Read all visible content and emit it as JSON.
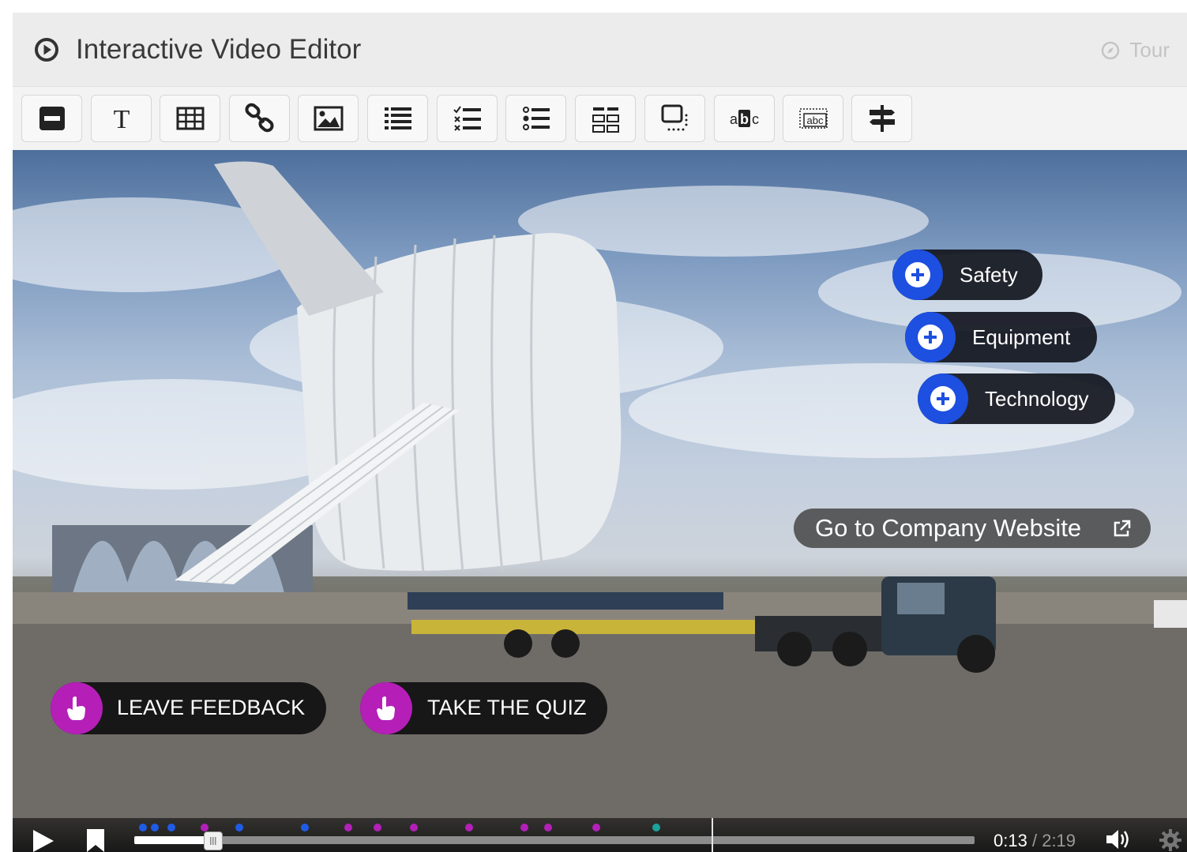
{
  "header": {
    "title": "Interactive Video Editor",
    "tour_label": "Tour"
  },
  "toolbar": {
    "tools": [
      {
        "icon": "minus-box-icon"
      },
      {
        "icon": "text-icon"
      },
      {
        "icon": "table-icon"
      },
      {
        "icon": "link-icon"
      },
      {
        "icon": "image-icon"
      },
      {
        "icon": "list-icon"
      },
      {
        "icon": "checklist-icon"
      },
      {
        "icon": "single-choice-icon"
      },
      {
        "icon": "drag-order-icon"
      },
      {
        "icon": "hotspot-area-icon"
      },
      {
        "icon": "mark-words-icon"
      },
      {
        "icon": "fill-blanks-icon"
      },
      {
        "icon": "crossroads-icon"
      }
    ]
  },
  "video": {
    "hotspots": [
      {
        "label": "Safety"
      },
      {
        "label": "Equipment"
      },
      {
        "label": "Technology"
      }
    ],
    "website_link": {
      "label": "Go to Company Website"
    },
    "actions": [
      {
        "label": "LEAVE FEEDBACK"
      },
      {
        "label": "TAKE THE QUIZ"
      }
    ]
  },
  "controls": {
    "current_time": "0:13",
    "separator": "/",
    "total_time": "2:19",
    "progress": 0.094,
    "marker_colors": {
      "blue": "#1f5ce6",
      "purple": "#b320b8",
      "teal": "#1aa39a"
    }
  },
  "colors": {
    "hotspot_blue": "#1d4fe0",
    "action_purple": "#b51fb8"
  }
}
